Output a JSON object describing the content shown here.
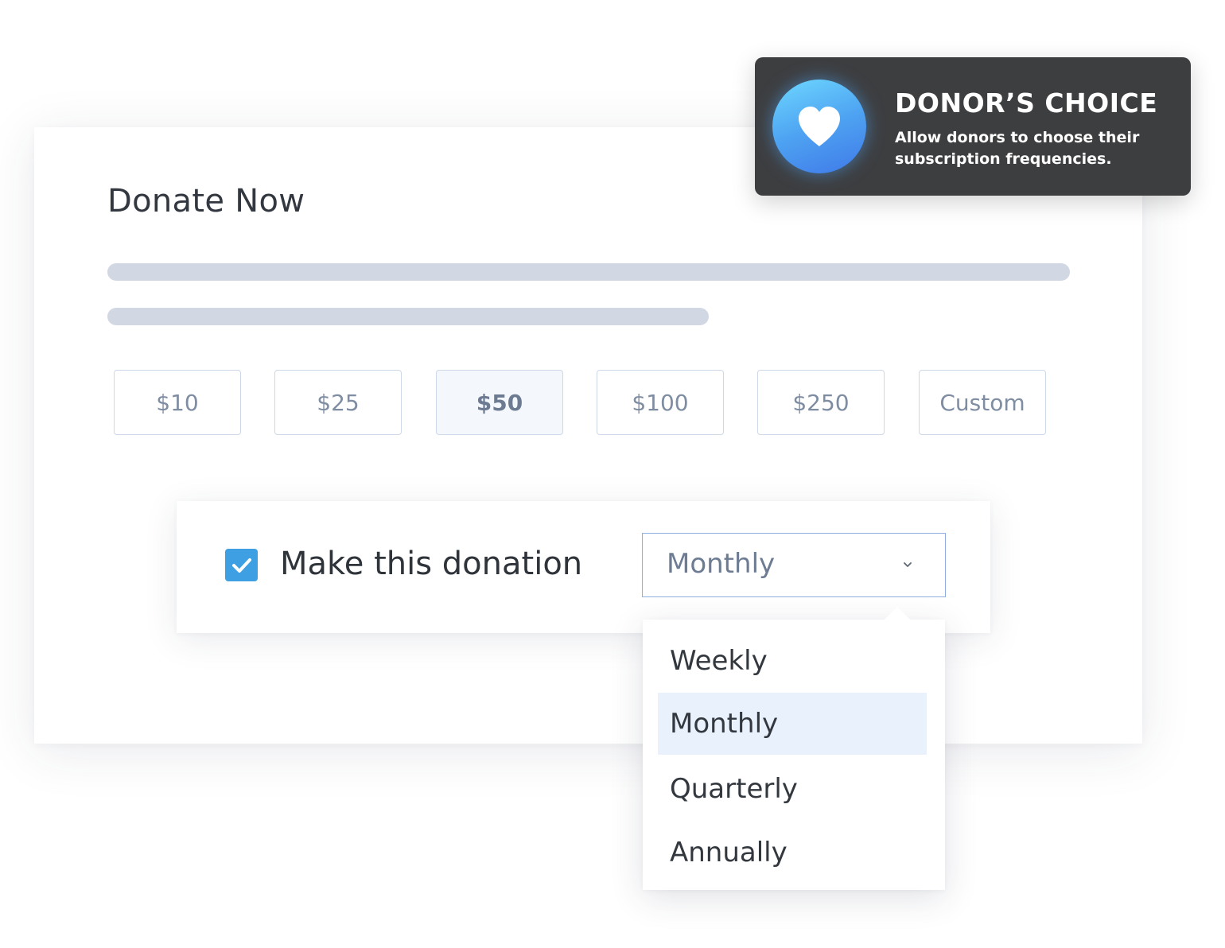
{
  "form": {
    "title": "Donate Now",
    "amounts": [
      "$10",
      "$25",
      "$50",
      "$100",
      "$250",
      "Custom"
    ],
    "selected_amount": "$50"
  },
  "recurring": {
    "checked": true,
    "label": "Make this donation",
    "selected_frequency": "Monthly",
    "options": [
      "Weekly",
      "Monthly",
      "Quarterly",
      "Annually"
    ]
  },
  "tooltip": {
    "title": "DONOR’S CHOICE",
    "description": "Allow donors to choose their subscription frequencies.",
    "icon": "heart-icon"
  },
  "colors": {
    "checkbox": "#3e9fe2",
    "selected_option_bg": "#e9f1fd",
    "tooltip_bg": "#3d3e40",
    "badge_gradient": [
      "#6ed8ff",
      "#3f79e8"
    ]
  }
}
